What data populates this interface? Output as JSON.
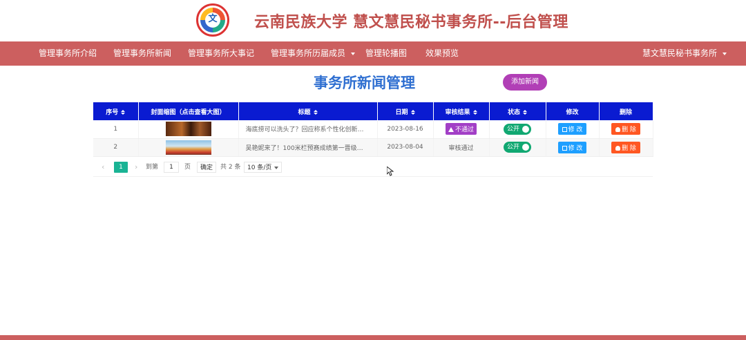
{
  "header": {
    "logo_icon": "university-logo-icon",
    "logo_glyph": "文",
    "title": "云南民族大学  慧文慧民秘书事务所--后台管理"
  },
  "nav": {
    "items": [
      {
        "label": "管理事务所介绍"
      },
      {
        "label": "管理事务所新闻"
      },
      {
        "label": "管理事务所大事记"
      },
      {
        "label": "管理事务所历届成员"
      },
      {
        "label": "管理轮播图"
      },
      {
        "label": "效果预览"
      }
    ],
    "user_menu": "慧文慧民秘书事务所"
  },
  "page": {
    "heading": "事务所新闻管理",
    "add_button": "添加新闻"
  },
  "table": {
    "columns": [
      "序号",
      "封面缩图（点击查看大图）",
      "标题",
      "日期",
      "审核结果",
      "状态",
      "修改",
      "删除"
    ],
    "rows": [
      {
        "index": "1",
        "title": "海底捞可以洗头了？回应称系个性化创新…",
        "date": "2023-08-16",
        "review": "不通过",
        "status": "公开",
        "edit": "修 改",
        "delete": "删 除"
      },
      {
        "index": "2",
        "title": "吴艳妮来了！100米栏预赛成绩第一晋级…",
        "date": "2023-08-04",
        "review": "审核通过",
        "status": "公开",
        "edit": "修 改",
        "delete": "删 除"
      }
    ]
  },
  "pager": {
    "current_page": "1",
    "goto_label": "到第",
    "goto_value": "1",
    "page_unit": "页",
    "confirm": "确定",
    "total": "共 2 条",
    "page_size": "10 条/页"
  },
  "colors": {
    "navbar": "#cc5f5f",
    "title": "#c0504d",
    "heading": "#2f6fd1",
    "table_header": "#0a1bd1",
    "add_button": "#b13fb6",
    "toggle": "#11a872",
    "edit": "#1e9fff",
    "delete": "#ff5722",
    "pager_active": "#1ab394"
  }
}
